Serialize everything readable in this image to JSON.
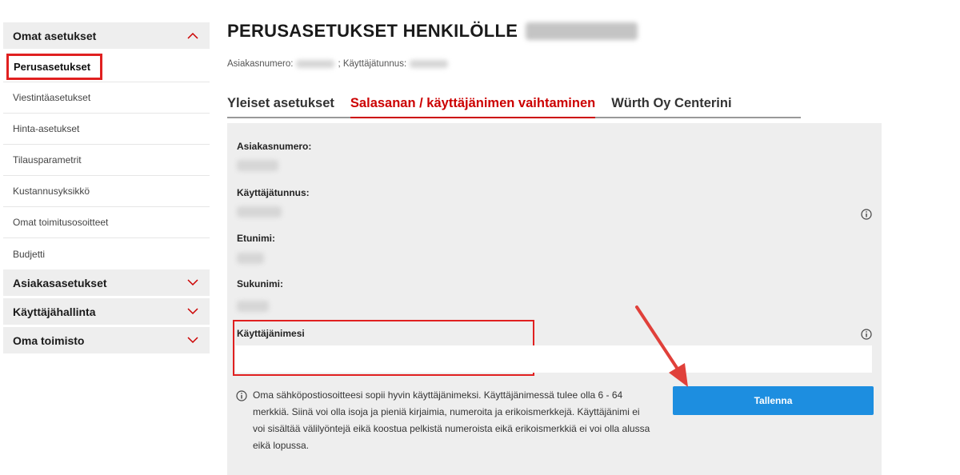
{
  "sidebar": {
    "groups": [
      {
        "label": "Omat asetukset",
        "expanded": true
      },
      {
        "label": "Asiakasasetukset",
        "expanded": false
      },
      {
        "label": "Käyttäjähallinta",
        "expanded": false
      },
      {
        "label": "Oma toimisto",
        "expanded": false
      }
    ],
    "items": [
      {
        "label": "Perusasetukset",
        "active": true
      },
      {
        "label": "Viestintäasetukset"
      },
      {
        "label": "Hinta-asetukset"
      },
      {
        "label": "Tilausparametrit"
      },
      {
        "label": "Kustannusyksikkö"
      },
      {
        "label": "Omat toimitusosoitteet"
      },
      {
        "label": "Budjetti"
      }
    ]
  },
  "header": {
    "title": "PERUSASETUKSET HENKILÖLLE",
    "customer_number_label": "Asiakasnumero:",
    "username_label": "; Käyttäjätunnus:"
  },
  "tabs": [
    {
      "label": "Yleiset asetukset",
      "active": false
    },
    {
      "label": "Salasanan / käyttäjänimen vaihtaminen",
      "active": true
    },
    {
      "label": "Würth Oy Centerini",
      "active": false
    }
  ],
  "form": {
    "fields": [
      {
        "label": "Asiakasnumero:"
      },
      {
        "label": "Käyttäjätunnus:"
      },
      {
        "label": "Etunimi:"
      },
      {
        "label": "Sukunimi:"
      }
    ],
    "username_field_label": "Käyttäjänimesi",
    "username_value": "",
    "help_text": "Oma sähköpostiosoitteesi sopii hyvin käyttäjänimeksi. Käyttäjänimessä tulee olla 6 - 64 merkkiä. Siinä voi olla isoja ja pieniä kirjaimia, numeroita ja erikoismerkkejä. Käyttäjänimi ei voi sisältää välilyöntejä eikä koostua pelkistä numeroista eikä erikoismerkkiä ei voi olla alussa eikä lopussa.",
    "save_label": "Tallenna"
  },
  "colors": {
    "accent_red": "#cc0000",
    "highlight_red": "#e02020",
    "button_blue": "#1d8ee0",
    "panel_gray": "#eeeeee"
  },
  "icons": {
    "info": "info-icon",
    "chevron_up": "chevron-up-icon",
    "chevron_down": "chevron-down-icon",
    "annotation_arrow": "annotation-arrow"
  }
}
